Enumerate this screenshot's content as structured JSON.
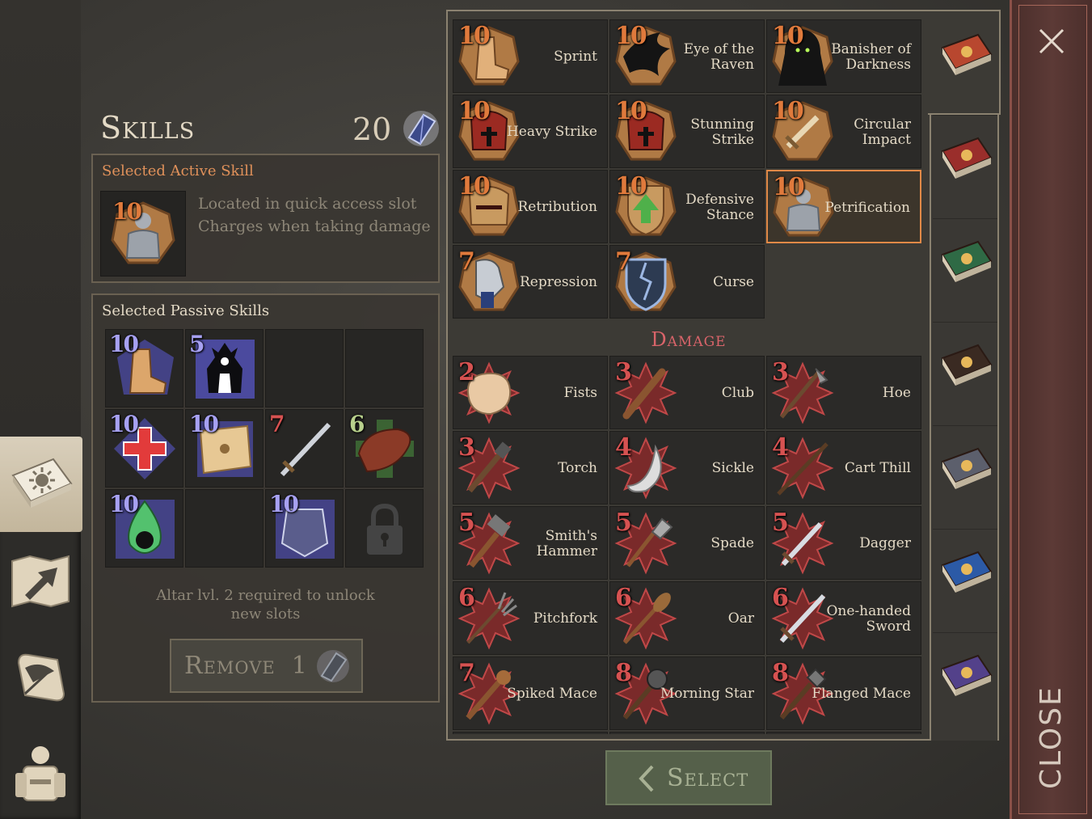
{
  "skills_header": {
    "title": "Skills",
    "count": "20",
    "currency_icon": "soul-crystal-icon"
  },
  "active_skill": {
    "label": "Selected Active Skill",
    "level": "10",
    "icon": "petrification-icon",
    "description_line1": "Located in quick access slot",
    "description_line2": "Charges when taking damage"
  },
  "passive_skills": {
    "label": "Selected Passive Skills",
    "slots": [
      {
        "level": "10",
        "color": "purple",
        "icon": "boot-icon"
      },
      {
        "level": "5",
        "color": "purple",
        "icon": "demon-silhouette-icon"
      },
      {
        "level": "",
        "color": "",
        "icon": "empty-slot"
      },
      {
        "level": "",
        "color": "",
        "icon": "empty-slot"
      },
      {
        "level": "10",
        "color": "purple",
        "icon": "red-cross-icon"
      },
      {
        "level": "10",
        "color": "purple",
        "icon": "map-icon"
      },
      {
        "level": "7",
        "color": "red",
        "icon": "sword-icon"
      },
      {
        "level": "6",
        "color": "green",
        "icon": "meat-icon"
      },
      {
        "level": "10",
        "color": "purple",
        "icon": "poison-skull-icon"
      },
      {
        "level": "",
        "color": "",
        "icon": "empty-slot"
      },
      {
        "level": "10",
        "color": "purple",
        "icon": "chest-armor-icon"
      },
      {
        "level": "",
        "color": "",
        "icon": "lock-icon"
      }
    ],
    "altar_note_line1": "Altar lvl. 2 required to unlock",
    "altar_note_line2": "new slots",
    "remove_label": "Remove",
    "remove_cost": "1"
  },
  "skill_rows": [
    [
      {
        "level": "10",
        "name": "Sprint",
        "icon": "boot-icon"
      },
      {
        "level": "10",
        "name": "Eye of the Raven",
        "icon": "raven-icon"
      },
      {
        "level": "10",
        "name": "Banisher of Darkness",
        "icon": "hooded-figure-icon"
      }
    ],
    [
      {
        "level": "10",
        "name": "Heavy Strike",
        "icon": "helmet-cross-icon"
      },
      {
        "level": "10",
        "name": "Stunning Strike",
        "icon": "helmet-stars-icon"
      },
      {
        "level": "10",
        "name": "Circular Impact",
        "icon": "sword-circle-icon"
      }
    ],
    [
      {
        "level": "10",
        "name": "Retribution",
        "icon": "spiked-helmet-icon"
      },
      {
        "level": "10",
        "name": "Defensive Stance",
        "icon": "shield-arrow-icon"
      },
      {
        "level": "10",
        "name": "Petrification",
        "icon": "petrification-icon",
        "selected": true
      }
    ],
    [
      {
        "level": "7",
        "name": "Repression",
        "icon": "gauntlet-chain-icon"
      },
      {
        "level": "7",
        "name": "Curse",
        "icon": "cracked-shield-icon"
      }
    ]
  ],
  "damage_section": {
    "title": "Damage",
    "rows": [
      [
        {
          "level": "2",
          "name": "Fists",
          "icon": "fist-icon"
        },
        {
          "level": "3",
          "name": "Club",
          "icon": "club-icon"
        },
        {
          "level": "3",
          "name": "Hoe",
          "icon": "hoe-icon"
        }
      ],
      [
        {
          "level": "3",
          "name": "Torch",
          "icon": "torch-icon"
        },
        {
          "level": "4",
          "name": "Sickle",
          "icon": "sickle-icon"
        },
        {
          "level": "4",
          "name": "Cart Thill",
          "icon": "cart-thill-icon"
        }
      ],
      [
        {
          "level": "5",
          "name": "Smith's Hammer",
          "icon": "hammer-icon"
        },
        {
          "level": "5",
          "name": "Spade",
          "icon": "spade-icon"
        },
        {
          "level": "5",
          "name": "Dagger",
          "icon": "dagger-icon"
        }
      ],
      [
        {
          "level": "6",
          "name": "Pitchfork",
          "icon": "pitchfork-icon"
        },
        {
          "level": "6",
          "name": "Oar",
          "icon": "oar-icon"
        },
        {
          "level": "6",
          "name": "One-handed Sword",
          "icon": "sword-icon"
        }
      ],
      [
        {
          "level": "7",
          "name": "Spiked Mace",
          "icon": "spiked-mace-icon"
        },
        {
          "level": "8",
          "name": "Morning Star",
          "icon": "morning-star-icon"
        },
        {
          "level": "8",
          "name": "Flanged Mace",
          "icon": "flanged-mace-icon"
        }
      ]
    ]
  },
  "book_tabs": [
    {
      "name": "sun-book-icon",
      "color": "#b8472f",
      "active": true
    },
    {
      "name": "sword-book-icon",
      "color": "#9a2e2b"
    },
    {
      "name": "cross-book-icon",
      "color": "#2f6a45"
    },
    {
      "name": "mask-book-icon",
      "color": "#3a2a22"
    },
    {
      "name": "pickaxe-book-icon",
      "color": "#5c5f6c"
    },
    {
      "name": "shield-book-icon",
      "color": "#2c5aa6"
    },
    {
      "name": "arrows-book-icon",
      "color": "#53418a"
    }
  ],
  "left_nav": [
    {
      "name": "skills-book-icon",
      "active": true
    },
    {
      "name": "map-arrow-icon"
    },
    {
      "name": "quill-scroll-icon"
    },
    {
      "name": "character-backpack-icon"
    }
  ],
  "select_label": "Select",
  "close_label": "CLOSE",
  "colors": {
    "accent_orange": "#e18947",
    "damage_title": "#d9646a",
    "close_strip": "#5c3a36"
  }
}
